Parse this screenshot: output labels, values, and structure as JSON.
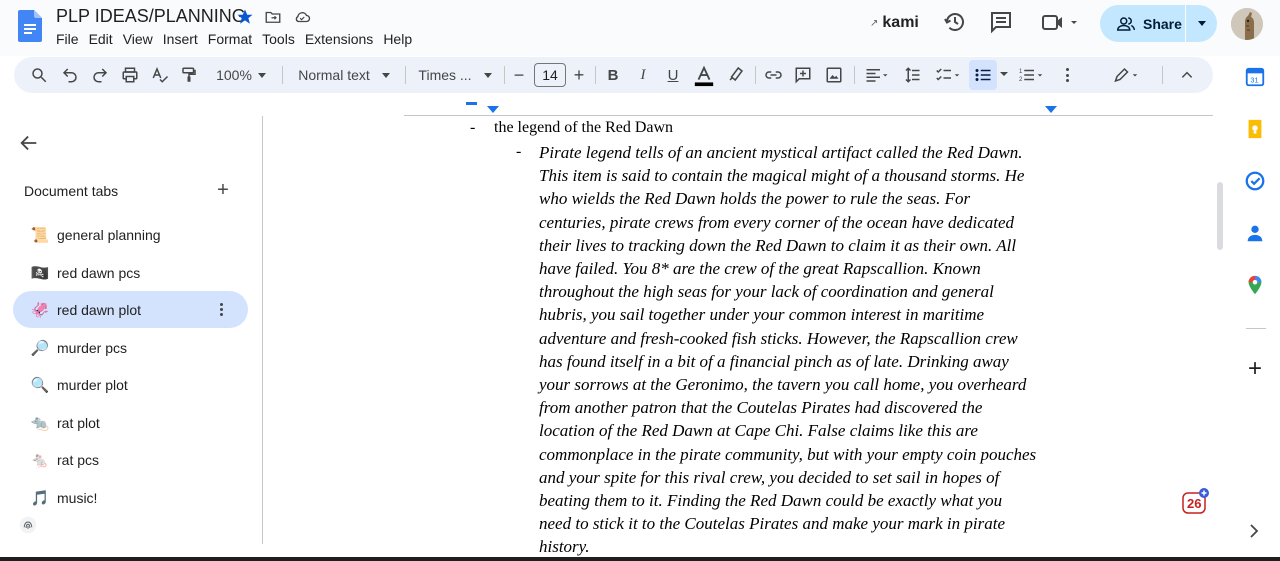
{
  "document": {
    "title": "PLP IDEAS/PLANNING"
  },
  "menu": [
    "File",
    "Edit",
    "View",
    "Insert",
    "Format",
    "Tools",
    "Extensions",
    "Help"
  ],
  "header": {
    "kami_label": "kami",
    "share_label": "Share"
  },
  "toolbar": {
    "zoom": "100%",
    "style": "Normal text",
    "font": "Times ...",
    "font_size": "14",
    "minus": "−",
    "plus": "+"
  },
  "sidebar": {
    "heading": "Document tabs",
    "add_symbol": "+",
    "tabs": [
      {
        "label": "general planning",
        "icon": "scroll-icon",
        "emoji": "📜",
        "active": false
      },
      {
        "label": "red dawn pcs",
        "icon": "pirate-flag-icon",
        "emoji": "🏴‍☠️",
        "active": false
      },
      {
        "label": "red dawn plot",
        "icon": "squid-icon",
        "emoji": "🦑",
        "active": true
      },
      {
        "label": "murder pcs",
        "icon": "magnifier-right-icon",
        "emoji": "🔎",
        "active": false
      },
      {
        "label": "murder plot",
        "icon": "magnifier-left-icon",
        "emoji": "🔍",
        "active": false
      },
      {
        "label": "rat plot",
        "icon": "rat-icon",
        "emoji": "🐀",
        "active": false
      },
      {
        "label": "rat pcs",
        "icon": "mouse-icon",
        "emoji": "🐁",
        "active": false
      },
      {
        "label": "music!",
        "icon": "music-note-icon",
        "emoji": "🎵",
        "active": false
      }
    ]
  },
  "body": {
    "bullet_marker": "-",
    "bullet_text": "the legend of the Red Dawn",
    "paragraph_lines": [
      "Pirate legend tells of an ancient mystical artifact called the Red Dawn.",
      "This item is said to contain the magical might of a thousand storms. He",
      "who wields the Red Dawn holds the power to rule the seas. For",
      "centuries, pirate crews from every corner of the ocean have dedicated",
      "their lives to tracking down the Red Dawn to claim it as their own. All",
      "have failed. You 8* are the crew of the great Rapscallion. Known",
      "throughout the high seas for your lack of coordination and general",
      "hubris, you sail together under your common interest in maritime",
      "adventure and fresh-cooked fish sticks. However, the Rapscallion crew",
      "has found itself in a bit of a financial pinch as of late. Drinking away",
      "your sorrows at the Geronimo, the tavern you call home, you overheard",
      "from another patron that the Coutelas Pirates had discovered the",
      "location of the Red Dawn at Cape Chi. False claims like this are",
      "commonplace in the pirate community, but with your empty coin pouches",
      "and your spite for this rival crew, you decided to set sail in hopes of",
      "beating them to it. Finding the Red Dawn could be exactly what you",
      "need to stick it to the Coutelas Pirates and make your mark in pirate",
      "history."
    ]
  },
  "notification": {
    "count": "26"
  },
  "colors": {
    "accent": "#0b57d0",
    "active_tab_bg": "#d3e3fd",
    "share_bg": "#c2e7ff",
    "toolbar_bg": "#edf2fa"
  }
}
